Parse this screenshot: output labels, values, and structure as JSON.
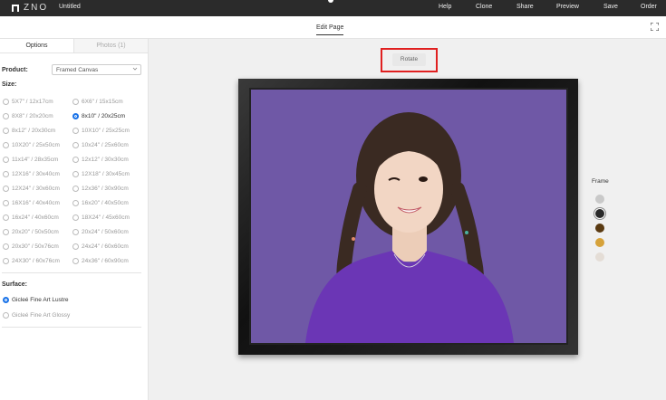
{
  "header": {
    "logo_text": "ZNO",
    "doc_title": "Untitled",
    "nav": [
      "Help",
      "Clone",
      "Share",
      "Preview",
      "Save",
      "Order"
    ]
  },
  "subbar": {
    "edit_label": "Edit Page"
  },
  "panel": {
    "tabs": [
      "Options",
      "Photos (1)"
    ],
    "product_label": "Product:",
    "product_value": "Framed Canvas",
    "size_label": "Size:",
    "sizes_left": [
      "5X7\" / 12x17cm",
      "8X8\" / 20x20cm",
      "8x12\" / 20x30cm",
      "10X20\" / 25x50cm",
      "11x14\" / 28x35cm",
      "12X16\" / 30x40cm",
      "12X24\" / 30x60cm",
      "16X16\" / 40x40cm",
      "16x24\" / 40x60cm",
      "20x20\" / 50x50cm",
      "20x30\" / 50x76cm",
      "24X30\" / 60x76cm"
    ],
    "sizes_right": [
      "6X6\" / 15x15cm",
      "8x10\" / 20x25cm",
      "10X10\" / 25x25cm",
      "10x24\" / 25x60cm",
      "12x12\" / 30x30cm",
      "12X18\" / 30x45cm",
      "12x36\" / 30x90cm",
      "16x20\" / 40x50cm",
      "18X24\" / 45x60cm",
      "20x24\" / 50x60cm",
      "24x24\" / 60x60cm",
      "24x36\" / 60x90cm"
    ],
    "selected_size": "8x10\" / 20x25cm",
    "surface_label": "Surface:",
    "surfaces": [
      "Gicleé Fine Art Lustre",
      "Gicleé Fine Art Glossy"
    ],
    "selected_surface": "Gicleé Fine Art Lustre"
  },
  "canvas": {
    "rotate_label": "Rotate",
    "frame_label": "Frame",
    "frame_colors": [
      "#c9c9c9",
      "#2a2a2a",
      "#5a3a12",
      "#d6a23a",
      "#e4ddd6"
    ],
    "selected_frame_color": "#2a2a2a",
    "photo_bg": "#6f58a6"
  }
}
